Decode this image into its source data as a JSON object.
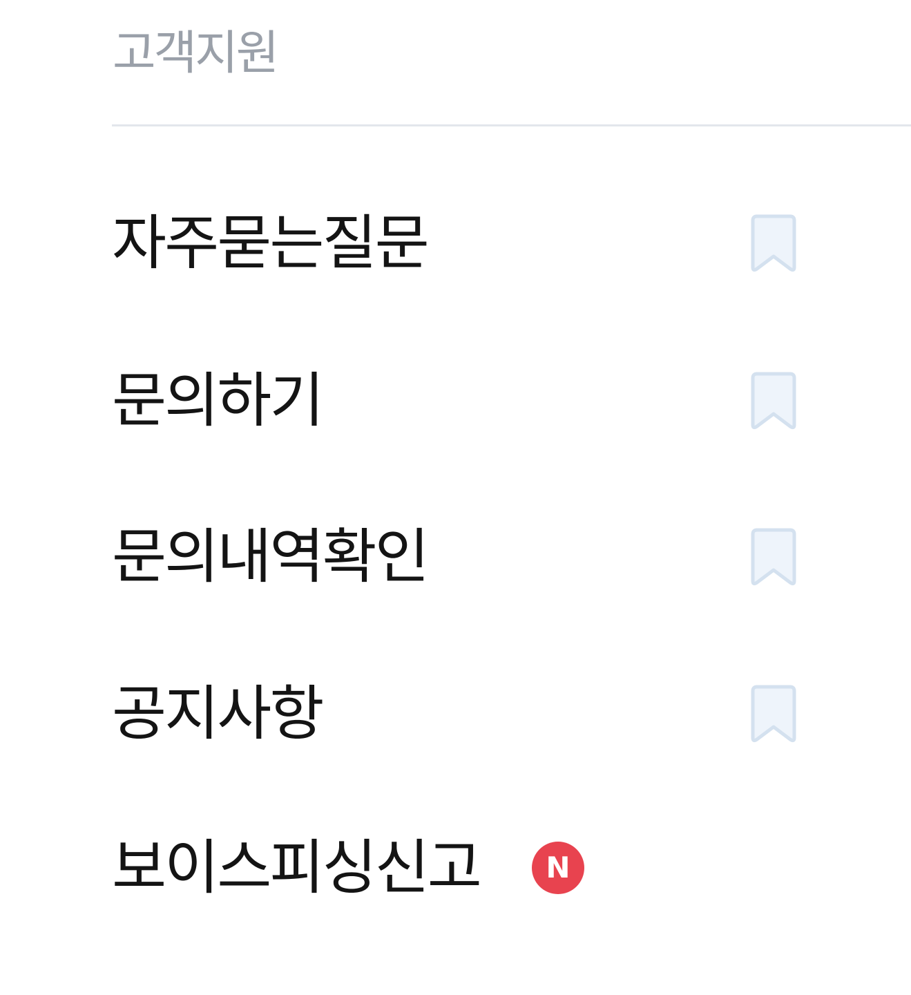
{
  "section": {
    "title": "고객지원"
  },
  "menu": {
    "items": [
      {
        "label": "자주묻는질문",
        "icon": "bookmark-icon"
      },
      {
        "label": "문의하기",
        "icon": "bookmark-icon"
      },
      {
        "label": "문의내역확인",
        "icon": "bookmark-icon"
      },
      {
        "label": "공지사항",
        "icon": "bookmark-icon"
      },
      {
        "label": "보이스피싱신고",
        "badge": "N"
      }
    ]
  },
  "colors": {
    "title_gray": "#9aa0a9",
    "text_dark": "#141414",
    "divider": "#e3e6ec",
    "bookmark_fill": "#eef4fb",
    "bookmark_stroke": "#d4e1ef",
    "badge_red": "#e8434f"
  }
}
